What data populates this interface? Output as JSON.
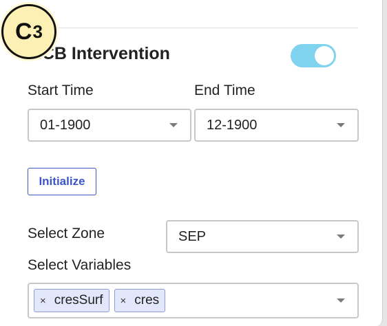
{
  "badge": {
    "letter": "C",
    "number": "3"
  },
  "section": {
    "title": "MCB Intervention",
    "toggle_on": true
  },
  "start_time": {
    "label": "Start Time",
    "value": "01-1900"
  },
  "end_time": {
    "label": "End Time",
    "value": "12-1900"
  },
  "initialize_button": "Initialize",
  "zone": {
    "label": "Select Zone",
    "value": "SEP"
  },
  "variables": {
    "label": "Select Variables",
    "selected": [
      {
        "remove": "×",
        "label": "cresSurf"
      },
      {
        "remove": "×",
        "label": "cres"
      }
    ]
  }
}
